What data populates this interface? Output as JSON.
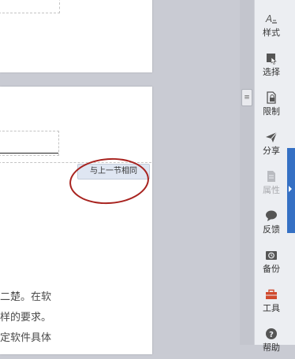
{
  "document": {
    "section_badge": "与上一节相同",
    "body_lines": [
      "二楚。在软",
      "样的要求。",
      "定软件具体"
    ]
  },
  "sidebar": {
    "items": [
      {
        "label": "样式",
        "icon": "style-icon",
        "enabled": true
      },
      {
        "label": "选择",
        "icon": "select-icon",
        "enabled": true
      },
      {
        "label": "限制",
        "icon": "restrict-icon",
        "enabled": true
      },
      {
        "label": "分享",
        "icon": "share-icon",
        "enabled": true
      },
      {
        "label": "属性",
        "icon": "properties-icon",
        "enabled": false
      },
      {
        "label": "反馈",
        "icon": "feedback-icon",
        "enabled": true
      },
      {
        "label": "备份",
        "icon": "backup-icon",
        "enabled": true
      },
      {
        "label": "工具",
        "icon": "toolbox-icon",
        "enabled": true
      },
      {
        "label": "帮助",
        "icon": "help-icon",
        "enabled": true
      }
    ]
  },
  "colors": {
    "annotation_ring": "#a8231f",
    "sidebar_accent": "#3570c4",
    "toolbox_icon": "#d04a2e"
  }
}
